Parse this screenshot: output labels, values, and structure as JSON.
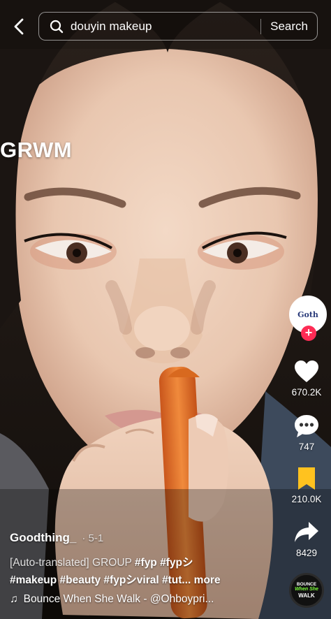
{
  "search": {
    "query": "douyin makeup",
    "submit_label": "Search"
  },
  "video": {
    "overlay_text": "GRWM"
  },
  "creator": {
    "avatar_text": "Goth",
    "follow_symbol": "+"
  },
  "actions": {
    "likes": "670.2K",
    "comments": "747",
    "saves": "210.0K",
    "shares": "8429"
  },
  "post": {
    "author": "Goodthing_",
    "date": "· 5-1",
    "desc_prefix": "[Auto-translated] GROUP ",
    "tags_line1": [
      "#fyp",
      "#fypシ"
    ],
    "tags_line2": [
      "#makeup",
      "#beauty",
      "#fypシviral",
      "#tut..."
    ],
    "more_label": "more"
  },
  "music": {
    "note": "♫",
    "title": "Bounce When She Walk - @Ohboypri...",
    "disc_line1": "BOUNCE",
    "disc_line2": "When She",
    "disc_line3": "WALK"
  },
  "colors": {
    "accent": "#fe2c55",
    "bookmark": "#ffc21f"
  },
  "icons": [
    "back-chevron-icon",
    "search-icon",
    "heart-icon",
    "comment-icon",
    "bookmark-icon",
    "share-icon",
    "music-note-icon",
    "plus-icon"
  ]
}
